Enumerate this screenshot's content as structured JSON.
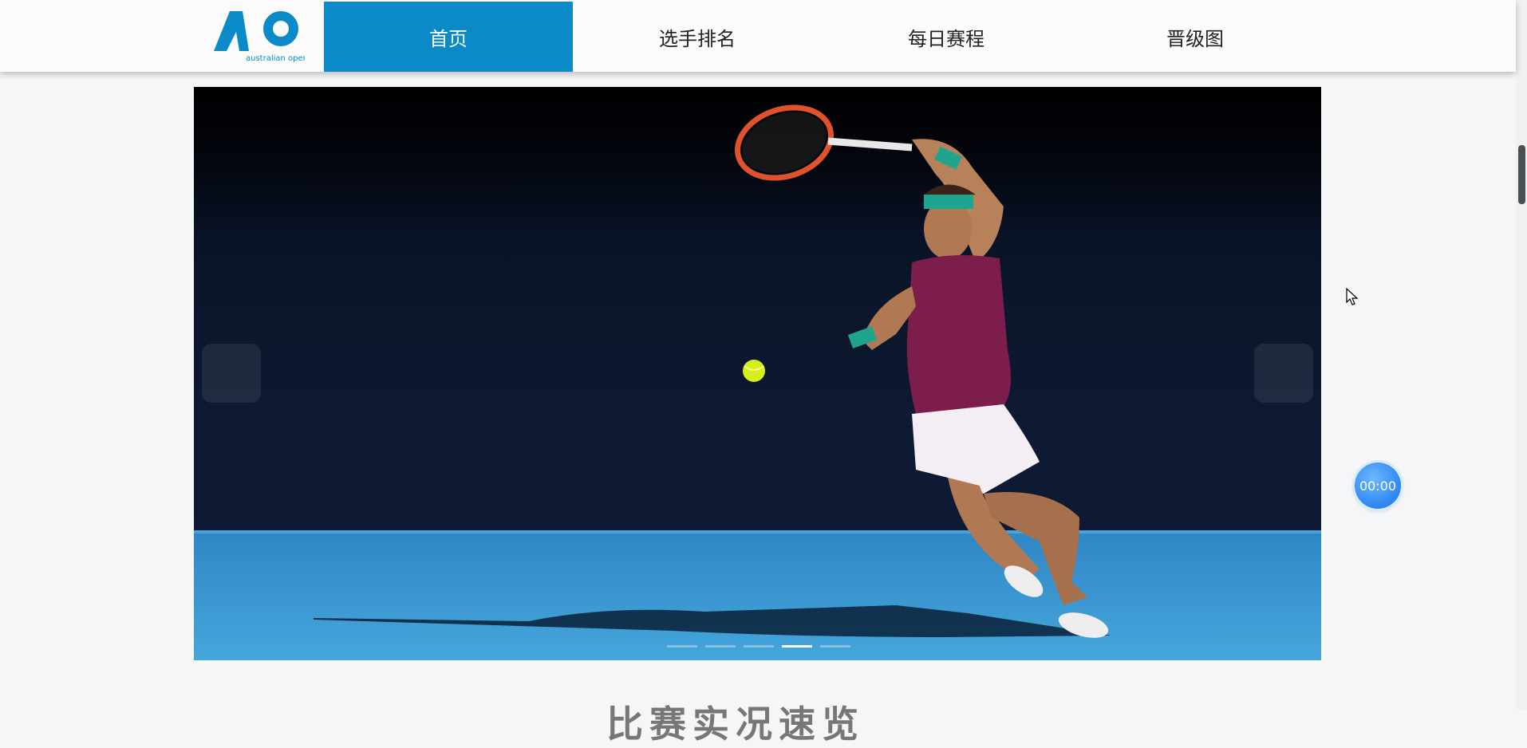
{
  "brand": {
    "logo_letters": "AO",
    "logo_subtitle": "australian open"
  },
  "nav": {
    "items": [
      {
        "label": "首页",
        "active": true
      },
      {
        "label": "选手排名",
        "active": false
      },
      {
        "label": "每日赛程",
        "active": false
      },
      {
        "label": "晋级图",
        "active": false
      }
    ]
  },
  "carousel": {
    "slide_count": 5,
    "active_index": 3,
    "icons": {
      "prev": "chevron-left-icon",
      "next": "chevron-right-icon"
    }
  },
  "timer": {
    "display": "00:00"
  },
  "section": {
    "title": "比赛实况速览"
  },
  "colors": {
    "accent": "#0a8ac7",
    "court": "#3f9ed4",
    "timer": "#2f86f0"
  }
}
